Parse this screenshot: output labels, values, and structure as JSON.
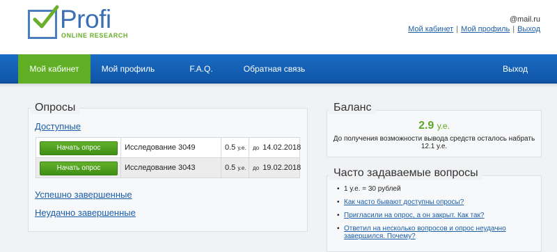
{
  "logo": {
    "word": "Profi",
    "subtitle": "ONLINE RESEARCH"
  },
  "header": {
    "email": "@mail.ru",
    "links": [
      {
        "label": "Мой кабинет"
      },
      {
        "label": "Мой профиль"
      },
      {
        "label": "Выход"
      }
    ]
  },
  "nav": {
    "items": [
      {
        "label": "Мой кабинет",
        "active": true
      },
      {
        "label": "Мой профиль",
        "active": false
      },
      {
        "label": "F.A.Q.",
        "active": false
      },
      {
        "label": "Обратная связь",
        "active": false
      },
      {
        "label": "Выход",
        "active": false
      }
    ],
    "colors": {
      "bar": "#1565bd",
      "active": "#5fae24"
    }
  },
  "surveys": {
    "title": "Опросы",
    "available_label": "Доступные",
    "start_label": "Начать опрос",
    "rows": [
      {
        "study": "Исследование 3049",
        "amount": "0.5",
        "unit": "у.е.",
        "date_prefix": "до",
        "date": "14.02.2018"
      },
      {
        "study": "Исследование 3043",
        "amount": "0.5",
        "unit": "у.е.",
        "date_prefix": "до",
        "date": "19.02.2018"
      }
    ],
    "completed_label": "Успешно завершенные",
    "failed_label": "Неудачно завершенные"
  },
  "balance": {
    "title": "Баланс",
    "value": "2.9",
    "unit": "у.е.",
    "note": "До получения возможности вывода средств осталось набрать 12.1 у.е."
  },
  "faq": {
    "title": "Часто задаваемые вопросы",
    "items": [
      {
        "text": "1 у.е. = 30 рублей",
        "link": false
      },
      {
        "text": "Как часто бывают доступны опросы?",
        "link": true
      },
      {
        "text": "Пригласили на опрос, а он закрыт. Как так?",
        "link": true
      },
      {
        "text": "Ответил на несколько вопросов и опрос неудачно завершился. Почему?",
        "link": true
      }
    ]
  }
}
